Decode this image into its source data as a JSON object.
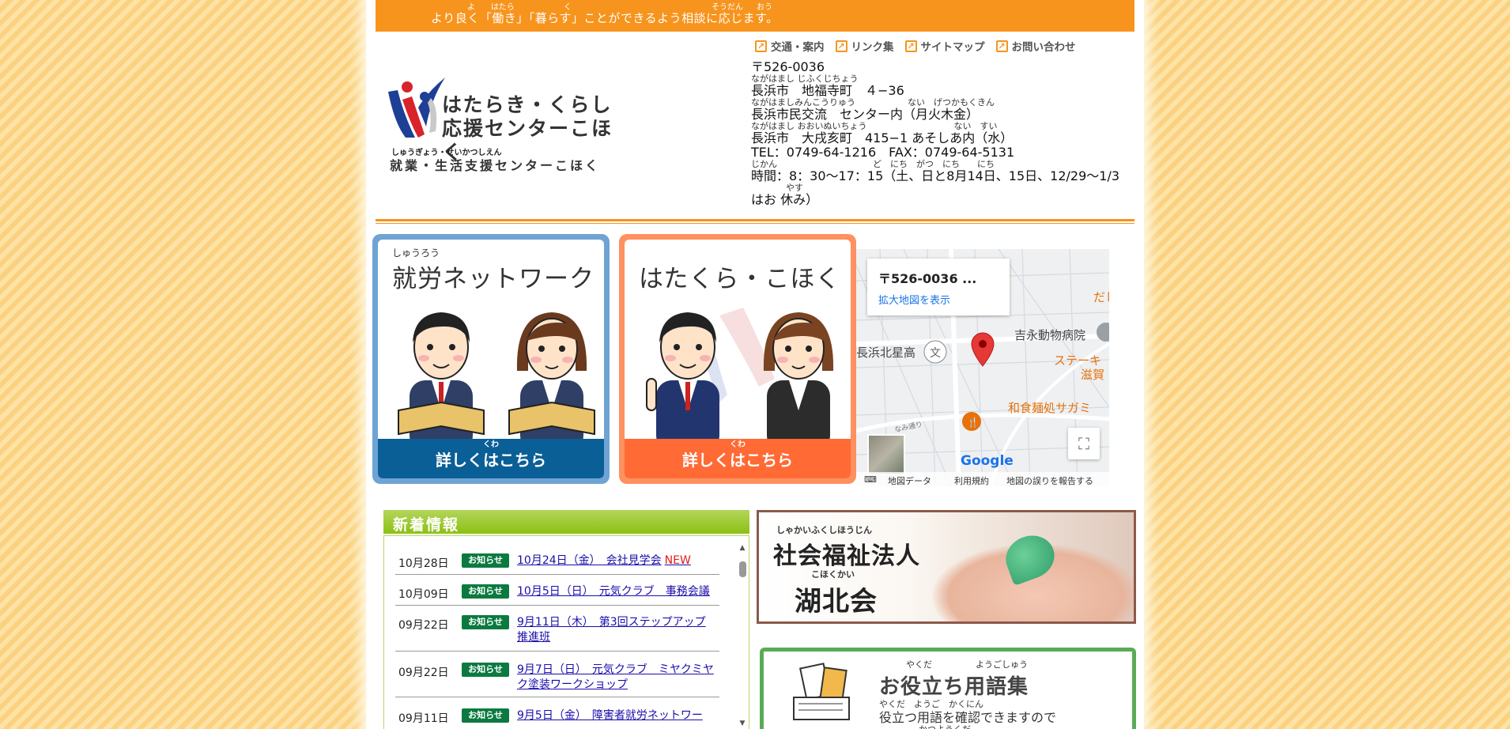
{
  "banner": {
    "message": "より良く「働き」「暮らす」ことができるよう相談に応じます。",
    "ruby": [
      "よ",
      "はたら",
      "く",
      "そうだん",
      "おう"
    ]
  },
  "nav": [
    {
      "label": "交通・案内"
    },
    {
      "label": "リンク集"
    },
    {
      "label": "サイトマップ"
    },
    {
      "label": "お問い合わせ"
    }
  ],
  "logo": {
    "title_line1": "はたらき・くらし",
    "title_line2": "応援センターこほく",
    "ruby": "しゅうぎょう・せいかつしえん",
    "subtitle": "就業・生活支援センターこほく"
  },
  "contact": {
    "postal": "〒526-0036",
    "ruby1": "ながはまし じふくじちょう",
    "address1": "長浜市　地福寺町　４−36",
    "ruby2": "ながはましみんこうりゅう　　　　　　ない　げつかもくきん",
    "address2": "長浜市民交流　センター内（月火木金）",
    "ruby3": "ながはまし おおいぬいちょう　　　　　　　　　　ない　すい",
    "address3": "長浜市　大戌亥町　415−1 あそしあ内（水）",
    "tel_fax": "TEL：0749-64-1216　FAX：0749-64-5131",
    "ruby4": "じかん　　　　　　　　　　　ど　にち　がつ　にち　　にち",
    "hours": "時間：8：30〜17：15（土、日と8月14日、15日、12/29〜1/3",
    "ruby5": "　　　　やす",
    "hours2": "はお 休み）"
  },
  "cards": [
    {
      "ruby": "しゅうろう",
      "title": "就労ネットワーク",
      "btn_ruby": "くわ",
      "button": "詳しくはこちら"
    },
    {
      "ruby": "",
      "title": "はたくら・こほく",
      "btn_ruby": "くわ",
      "button": "詳しくはこちら"
    }
  ],
  "map": {
    "info_title": "〒526-0036 ...",
    "info_link": "拡大地図を表示",
    "labels": [
      "だし",
      "吉永動物病院",
      "長浜北星高",
      "ステーキ",
      "滋賀",
      "和食麺処サガミ",
      "なみ通り"
    ],
    "footer": [
      "地図データ",
      "利用規約",
      "地図の誤りを報告する"
    ],
    "brand": "Google",
    "colors": {
      "pin": "#e53935",
      "poi": "#e8710a",
      "brand": "#1a73e8"
    }
  },
  "news": {
    "heading": "新着情報",
    "items": [
      {
        "date": "10月28日",
        "badge": "お知らせ",
        "title": "10月24日（金）　会社見学会",
        "new": "NEW"
      },
      {
        "date": "10月09日",
        "badge": "お知らせ",
        "title": "10月5日（日）　元気クラブ　事務会議",
        "new": ""
      },
      {
        "date": "09月22日",
        "badge": "お知らせ",
        "title": "9月11日（木）　第3回ステップアップ推進班",
        "new": ""
      },
      {
        "date": "09月22日",
        "badge": "お知らせ",
        "title": "9月7日（日）　元気クラブ　ミヤクミヤク塗装ワークショップ",
        "new": ""
      },
      {
        "date": "09月11日",
        "badge": "お知らせ",
        "title": "9月5日（金）　障害者就労ネットワー",
        "new": ""
      }
    ]
  },
  "welfare": {
    "ruby1": "しゃかいふくしほうじん",
    "title1": "社会福祉法人",
    "ruby2": "こほくかい",
    "title2": "湖北会"
  },
  "glossary": {
    "ruby1": "やくだ　　　　　ようごしゅう",
    "title": "お役立ち用語集",
    "ruby2": "やくだ　ようご　かくにん",
    "sub": "役立つ用語を確認できますので",
    "ruby3": "かつようくだ"
  }
}
